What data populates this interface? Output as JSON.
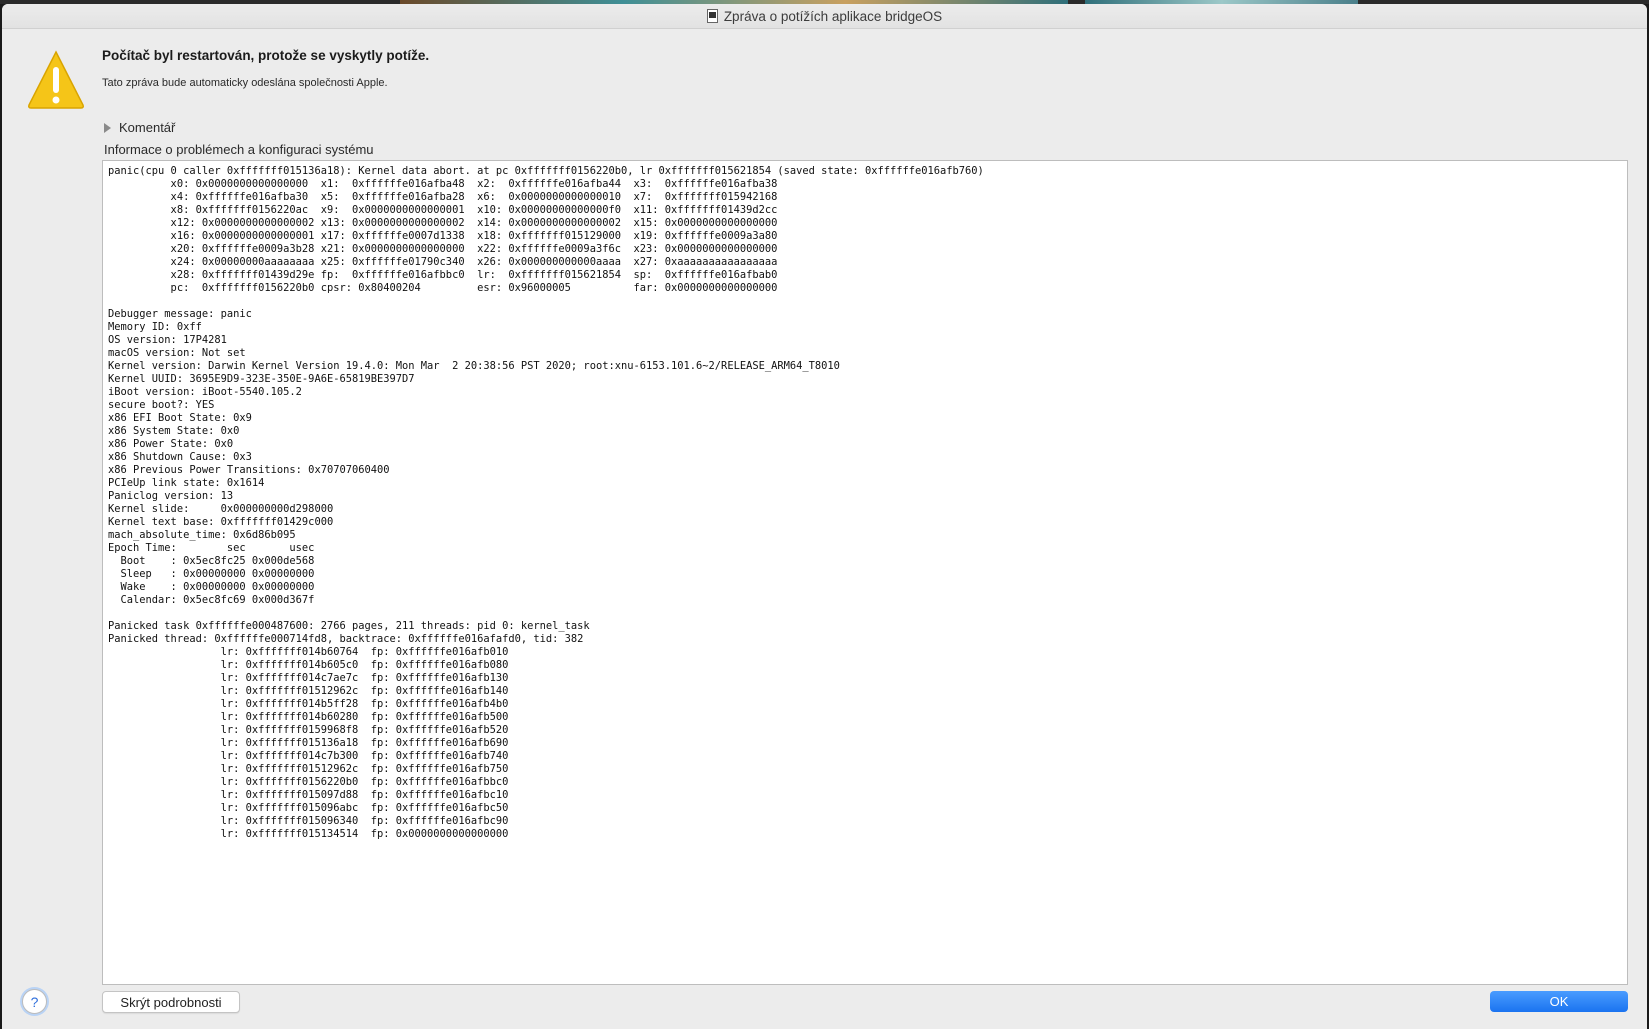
{
  "window": {
    "title": "Zpráva o potížích aplikace bridgeOS"
  },
  "dialog": {
    "headline": "Počítač byl restartován, protože se vyskytly potíže.",
    "subtext": "Tato zpráva bude automaticky odeslána společnosti Apple.",
    "comment_label": "Komentář",
    "section_label": "Informace o problémech a konfiguraci systému",
    "log_text": "panic(cpu 0 caller 0xfffffff015136a18): Kernel data abort. at pc 0xfffffff0156220b0, lr 0xfffffff015621854 (saved state: 0xffffffe016afb760)\n\t  x0: 0x0000000000000000  x1:  0xffffffe016afba48  x2:  0xffffffe016afba44  x3:  0xffffffe016afba38\n\t  x4: 0xffffffe016afba30  x5:  0xffffffe016afba28  x6:  0x0000000000000010  x7:  0xfffffff015942168\n\t  x8: 0xfffffff0156220ac  x9:  0x0000000000000001  x10: 0x00000000000000f0  x11: 0xfffffff01439d2cc\n\t  x12: 0x0000000000000002 x13: 0x0000000000000002  x14: 0x0000000000000002  x15: 0x0000000000000000\n\t  x16: 0x0000000000000001 x17: 0xffffffe0007d1338  x18: 0xfffffff015129000  x19: 0xffffffe0009a3a80\n\t  x20: 0xffffffe0009a3b28 x21: 0x0000000000000000  x22: 0xffffffe0009a3f6c  x23: 0x0000000000000000\n\t  x24: 0x00000000aaaaaaaa x25: 0xffffffe01790c340  x26: 0x000000000000aaaa  x27: 0xaaaaaaaaaaaaaaaa\n\t  x28: 0xfffffff01439d29e fp:  0xffffffe016afbbc0  lr:  0xfffffff015621854  sp:  0xffffffe016afbab0\n\t  pc:  0xfffffff0156220b0 cpsr: 0x80400204         esr: 0x96000005          far: 0x0000000000000000\n\nDebugger message: panic\nMemory ID: 0xff\nOS version: 17P4281\nmacOS version: Not set\nKernel version: Darwin Kernel Version 19.4.0: Mon Mar  2 20:38:56 PST 2020; root:xnu-6153.101.6~2/RELEASE_ARM64_T8010\nKernel UUID: 3695E9D9-323E-350E-9A6E-65819BE397D7\niBoot version: iBoot-5540.105.2\nsecure boot?: YES\nx86 EFI Boot State: 0x9\nx86 System State: 0x0\nx86 Power State: 0x0\nx86 Shutdown Cause: 0x3\nx86 Previous Power Transitions: 0x70707060400\nPCIeUp link state: 0x1614\nPaniclog version: 13\nKernel slide:     0x000000000d298000\nKernel text base: 0xfffffff01429c000\nmach_absolute_time: 0x6d86b095\nEpoch Time:        sec       usec\n  Boot    : 0x5ec8fc25 0x000de568\n  Sleep   : 0x00000000 0x00000000\n  Wake    : 0x00000000 0x00000000\n  Calendar: 0x5ec8fc69 0x000d367f\n\nPanicked task 0xffffffe000487600: 2766 pages, 211 threads: pid 0: kernel_task\nPanicked thread: 0xffffffe000714fd8, backtrace: 0xffffffe016afafd0, tid: 382\n\t\t  lr: 0xfffffff014b60764  fp: 0xffffffe016afb010\n\t\t  lr: 0xfffffff014b605c0  fp: 0xffffffe016afb080\n\t\t  lr: 0xfffffff014c7ae7c  fp: 0xffffffe016afb130\n\t\t  lr: 0xfffffff01512962c  fp: 0xffffffe016afb140\n\t\t  lr: 0xfffffff014b5ff28  fp: 0xffffffe016afb4b0\n\t\t  lr: 0xfffffff014b60280  fp: 0xffffffe016afb500\n\t\t  lr: 0xfffffff0159968f8  fp: 0xffffffe016afb520\n\t\t  lr: 0xfffffff015136a18  fp: 0xffffffe016afb690\n\t\t  lr: 0xfffffff014c7b300  fp: 0xffffffe016afb740\n\t\t  lr: 0xfffffff01512962c  fp: 0xffffffe016afb750\n\t\t  lr: 0xfffffff0156220b0  fp: 0xffffffe016afbbc0\n\t\t  lr: 0xfffffff015097d88  fp: 0xffffffe016afbc10\n\t\t  lr: 0xfffffff015096abc  fp: 0xffffffe016afbc50\n\t\t  lr: 0xfffffff015096340  fp: 0xffffffe016afbc90\n\t\t  lr: 0xfffffff015134514  fp: 0x0000000000000000"
  },
  "buttons": {
    "help_label": "?",
    "hide_details_label": "Skrýt podrobnosti",
    "ok_label": "OK"
  },
  "icons": {
    "warning": "warning-icon",
    "disclosure": "disclosure-triangle-icon",
    "document": "document-icon",
    "help": "help-icon"
  },
  "colors": {
    "accent": "#1a73f0",
    "warning_yellow": "#f5c518",
    "window_bg": "#ececec"
  }
}
